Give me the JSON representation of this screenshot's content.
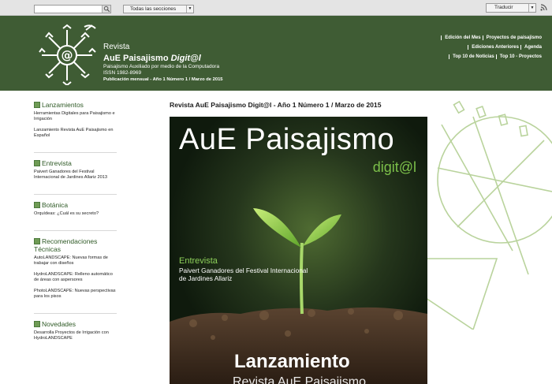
{
  "topbar": {
    "search_value": "",
    "sections_select": "Todas las secciones",
    "translate_select": "Traducir"
  },
  "brand": {
    "revista": "Revista",
    "title_main": "AuE Paisajismo ",
    "title_em": "Digit@l",
    "tagline": "Paisajismo Auxiliado por medio de la Computadora",
    "issn": "ISSN 1982-8969",
    "publication": "Publicación mensual - Año 1 Número 1 / Marzo de 2015"
  },
  "nav": {
    "row1": [
      "Edición del Mes",
      "Proyectos de paisajismo"
    ],
    "row2": [
      "Ediciones Anteriores",
      "Agenda"
    ],
    "row3": [
      "Top 10 de Noticias",
      "Top 10 - Proyectos"
    ]
  },
  "sidebar": {
    "sections": [
      {
        "title": "Lanzamientos",
        "items": [
          "Herramientas Digitales para Paisajismo e Irrigación",
          "Lanzamiento Revista AuE Paisajismo en Español"
        ]
      },
      {
        "title": "Entrevista",
        "items": [
          "Paivert Ganadores del Festival Internacional de Jardines Allariz 2013"
        ]
      },
      {
        "title": "Botánica",
        "items": [
          "Orquídeas: ¿Cuál es su secreto?"
        ]
      },
      {
        "title": "Recomendaciones Técnicas",
        "items": [
          "AutoLANDSCAPE: Nuevas formas de trabajar con diseños",
          "HydroLANDSCAPE: Relleno automático de áreas con aspersores",
          "PhotoLANDSCAPE: Nuevas perspectivas para los pisos"
        ]
      },
      {
        "title": "Novedades",
        "items": [
          "Desarrolla Proyectos de Irrigación con HydroLANDSCAPE"
        ]
      }
    ]
  },
  "main": {
    "heading": "Revista AuE Paisajismo Digit@l - Año 1 Número 1 / Marzo de 2015"
  },
  "cover": {
    "title": "AuE Paisajismo",
    "digital": "digit@l",
    "section": "Entrevista",
    "text": "Paivert Ganadores del Festival Internacional de Jardines Allariz",
    "launch": "Lanzamiento",
    "launch_sub": "Revista AuE Paisajismo"
  },
  "colors": {
    "header_bg": "#3f5c34",
    "accent_green": "#7cc04a",
    "sidebar_heading": "#2f5a26"
  }
}
